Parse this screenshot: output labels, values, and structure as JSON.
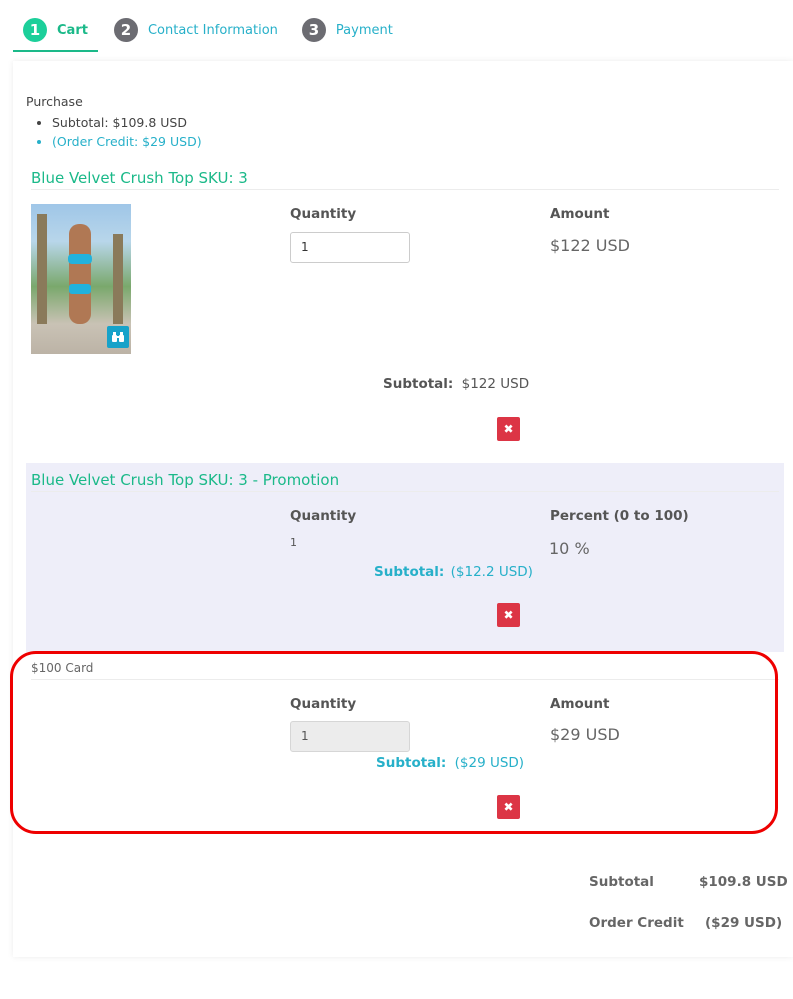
{
  "steps": [
    {
      "num": "1",
      "label": "Cart"
    },
    {
      "num": "2",
      "label": "Contact Information"
    },
    {
      "num": "3",
      "label": "Payment"
    }
  ],
  "purchase": {
    "heading": "Purchase",
    "subtotal": "Subtotal: $109.8 USD",
    "credit": "(Order Credit: $29 USD)"
  },
  "items": [
    {
      "title": "Blue Velvet Crush Top SKU: 3",
      "qty_label": "Quantity",
      "qty_value": "1",
      "amount_label": "Amount",
      "amount": "$122 USD",
      "subtotal_label": "Subtotal:",
      "subtotal_value": "$122 USD",
      "delete_icon": "x-icon"
    },
    {
      "title": "Blue Velvet Crush Top SKU: 3 - Promotion",
      "qty_label": "Quantity",
      "qty_value": "1",
      "amount_label": "Percent (0 to 100)",
      "amount": "10 %",
      "subtotal_label": "Subtotal:",
      "subtotal_value": "($12.2 USD)",
      "delete_icon": "x-icon"
    },
    {
      "title": "$100 Card",
      "qty_label": "Quantity",
      "qty_value": "1",
      "amount_label": "Amount",
      "amount": "$29 USD",
      "subtotal_label": "Subtotal:",
      "subtotal_value": "($29 USD)",
      "delete_icon": "x-icon"
    }
  ],
  "totals": {
    "subtotal_label": "Subtotal",
    "subtotal_value": "$109.8 USD",
    "credit_label": "Order Credit",
    "credit_value": "($29 USD)"
  },
  "colors": {
    "accent_green": "#1bb989",
    "accent_blue": "#27b0c9",
    "danger": "#dc3545",
    "highlight": "#ee0000"
  }
}
